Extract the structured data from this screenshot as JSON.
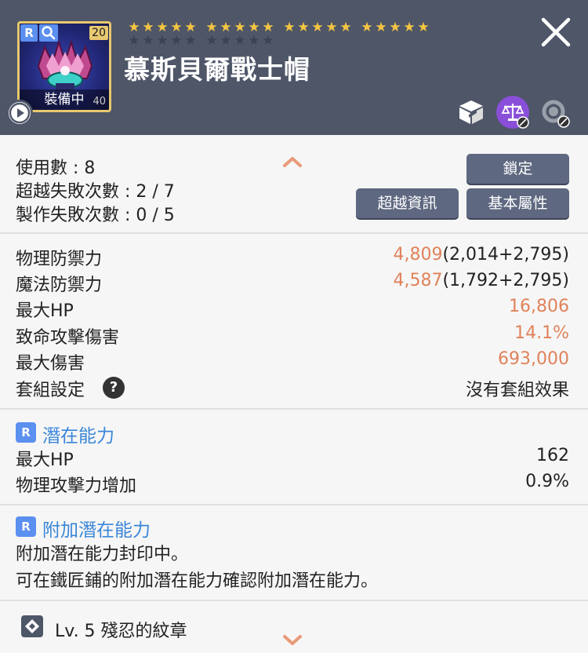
{
  "header": {
    "rank_badge": "R",
    "level_badge": "20",
    "equipped_label": "裝備中",
    "equipped_small": "40",
    "title": "慕斯貝爾戰士帽",
    "stars_gold": 20,
    "stars_total": 30
  },
  "usage": {
    "uses": "使用數 : 8",
    "transcend_fails": "超越失敗次數 : 2 / 7",
    "craft_fails": "製作失敗次數 : 0 / 5",
    "lock_button": "鎖定",
    "transcend_info_button": "超越資訊",
    "base_attr_button": "基本屬性"
  },
  "stats": [
    {
      "label": "物理防禦力",
      "value_orange": "4,809",
      "value_rest": "(2,014+2,795)"
    },
    {
      "label": "魔法防禦力",
      "value_orange": "4,587",
      "value_rest": "(1,792+2,795)"
    },
    {
      "label": "最大HP",
      "value_orange": "16,806",
      "value_rest": ""
    },
    {
      "label": "致命攻擊傷害",
      "value_orange": "14.1%",
      "value_rest": ""
    },
    {
      "label": "最大傷害",
      "value_orange": "693,000",
      "value_rest": ""
    },
    {
      "label": "套組設定",
      "value_orange": "",
      "value_rest": "沒有套組效果"
    }
  ],
  "potential": {
    "tag": "R",
    "title": "潛在能力",
    "rows": [
      {
        "label": "最大HP",
        "value": "162"
      },
      {
        "label": "物理攻擊力增加",
        "value": "0.9%"
      }
    ]
  },
  "additional_potential": {
    "tag": "R",
    "title": "附加潛在能力",
    "line1": "附加潛在能力封印中。",
    "line2": "可在鐵匠鋪的附加潛在能力確認附加潛在能力。"
  },
  "emblem": {
    "label": "Lv. 5 殘忍的紋章"
  },
  "colors": {
    "header_bg": "#4e5668",
    "accent_orange": "#e0825a",
    "accent_blue": "#3a86d8",
    "button_bg": "#5e6880",
    "star_gold": "#f5c542"
  }
}
